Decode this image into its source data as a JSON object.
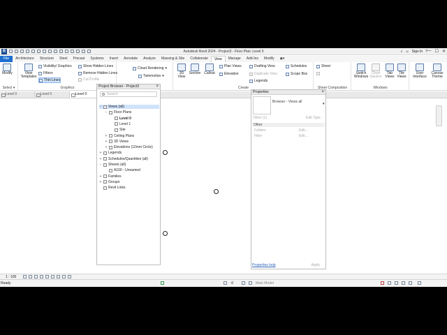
{
  "title_bar": {
    "app_letter": "R",
    "title": "Autodesk Revit 2024 - Project3 - Floor Plan: Level 0",
    "sign_in": "Sign In",
    "help": "?"
  },
  "window_controls": {
    "minimize": "—",
    "maximize": "☐",
    "close": "✕"
  },
  "ribbon_tabs": [
    "File",
    "Architecture",
    "Structure",
    "Steel",
    "Precast",
    "Systems",
    "Insert",
    "Annotate",
    "Analyze",
    "Massing & Site",
    "Collaborate",
    "View",
    "Manage",
    "Add-Ins",
    "Modify",
    "◉▾"
  ],
  "active_tab": "View",
  "ribbon": {
    "select": {
      "modify": "Modify",
      "title": "Select ▾"
    },
    "graphics": {
      "view_templates": "View Templates",
      "visibility_graphics": "Visibility/ Graphics",
      "filters": "Filters",
      "thin_lines": "Thin Lines",
      "show_hidden_lines": "Show Hidden Lines",
      "remove_hidden_lines": "Remove Hidden Lines",
      "cut_profile": "Cut Profile",
      "title": "Graphics"
    },
    "presentation": {
      "cloud_rendering": "Cloud Rendering",
      "twinmotion": "Twinmotion"
    },
    "create": {
      "view_3d": "3D View",
      "section": "Section",
      "callout": "Callout",
      "plan_views": "Plan Views",
      "elevation": "Elevation",
      "drafting_view": "Drafting View",
      "duplicate_view": "Duplicate View",
      "legends": "Legends",
      "schedules": "Schedules",
      "scope_box": "Scope Box",
      "title": "Create"
    },
    "sheet_composition": {
      "sheet": "Sheet",
      "title": "Sheet Composition"
    },
    "windows": {
      "switch_windows": "Switch Windows",
      "close_inactive": "Close Inactive",
      "tab_views": "Tab Views",
      "tile_views": "Tile Views",
      "title": "Windows"
    },
    "user_interface": "User Interface",
    "canvas_theme": "Canvas Theme"
  },
  "select_label": "Select ▾",
  "view_tabs": [
    "Level 0",
    "Level 0",
    "Level 0"
  ],
  "project_browser": {
    "title": "Project Browser - Project3",
    "search_placeholder": "Search",
    "tree": [
      {
        "label": "Views (all)",
        "toggle": "−",
        "depth": 0,
        "selected": true
      },
      {
        "label": "Floor Plans",
        "toggle": "−",
        "depth": 1
      },
      {
        "label": "Level 0",
        "toggle": "",
        "depth": 2,
        "bold": true
      },
      {
        "label": "Level 1",
        "toggle": "",
        "depth": 2
      },
      {
        "label": "Site",
        "toggle": "",
        "depth": 2
      },
      {
        "label": "Ceiling Plans",
        "toggle": "+",
        "depth": 1
      },
      {
        "label": "3D Views",
        "toggle": "+",
        "depth": 1
      },
      {
        "label": "Elevations (12mm Circle)",
        "toggle": "+",
        "depth": 1
      },
      {
        "label": "Legends",
        "toggle": "+",
        "depth": 0
      },
      {
        "label": "Schedules/Quantities (all)",
        "toggle": "+",
        "depth": 0
      },
      {
        "label": "Sheets (all)",
        "toggle": "−",
        "depth": 0
      },
      {
        "label": "A100 - Unnamed",
        "toggle": "",
        "depth": 1
      },
      {
        "label": "Families",
        "toggle": "+",
        "depth": 0
      },
      {
        "label": "Groups",
        "toggle": "+",
        "depth": 0
      },
      {
        "label": "Revit Links",
        "toggle": "",
        "depth": 0
      }
    ]
  },
  "properties": {
    "title": "Properties",
    "type_label": "Browser - Views all",
    "filter": "Other (1)",
    "edit_type": "Edit Type",
    "section": "Other",
    "rows": [
      {
        "name": "Folders",
        "value": "Edit..."
      },
      {
        "name": "Filter",
        "value": "Edit..."
      }
    ],
    "help_link": "Properties help",
    "apply": "Apply"
  },
  "scale_bar": {
    "scale": "1 : 100"
  },
  "status_bar": {
    "status": "Ready",
    "coord": ":0",
    "model": "Main Model"
  }
}
